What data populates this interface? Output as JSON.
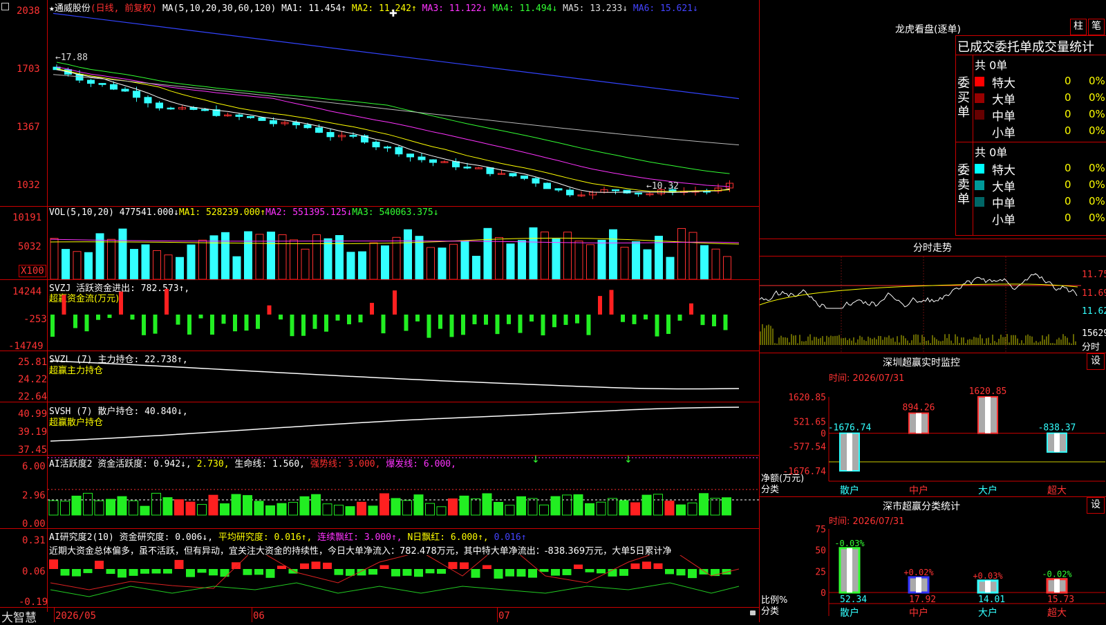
{
  "stock": {
    "name": "★通威股份",
    "mode": "(日线, 前复权)",
    "ma_label": "MA(5,10,20,30,60,120)",
    "ma_values": [
      {
        "label": "MA1:",
        "value": "11.454↑",
        "color": "#ffffff"
      },
      {
        "label": "MA2:",
        "value": "11.242↑",
        "color": "#ffff00"
      },
      {
        "label": "MA3:",
        "value": "11.122↓",
        "color": "#ff33ff"
      },
      {
        "label": "MA4:",
        "value": "11.494↓",
        "color": "#33ff33"
      },
      {
        "label": "MA5:",
        "value": "13.233↓",
        "color": "#dddddd"
      },
      {
        "label": "MA6:",
        "value": "15.621↓",
        "color": "#4444ff"
      }
    ],
    "high_marker": "←17.88",
    "low_marker": "←10.32"
  },
  "price_axis": [
    "2038",
    "1703",
    "1367",
    "1032"
  ],
  "vol": {
    "header": "VOL(5,10,20)",
    "value": "477541.000↓",
    "ma1": "MA1: 528239.000↑",
    "ma2": "MA2: 551395.125↓",
    "ma3": "MA3: 540063.375↓",
    "axis": [
      "10191",
      "5032"
    ],
    "unit": "X100"
  },
  "svzj": {
    "header": "SVZJ  活跃资金进出: 782.573↑,",
    "sub": "超赢资金流(万元)",
    "axis": [
      "14244",
      "-253",
      "-14749"
    ]
  },
  "svzl": {
    "header": "SVZL (7) 主力持仓: 22.738↑,",
    "sub": "超赢主力持仓",
    "axis": [
      "25.81",
      "24.22",
      "22.64"
    ]
  },
  "svsh": {
    "header": "SVSH (7) 散户持仓: 40.840↓,",
    "sub": "超赢散户持仓",
    "axis": [
      "40.99",
      "39.19",
      "37.45"
    ]
  },
  "ai1": {
    "header": "AI活跃度2 资金活跃度: 0.942↓,",
    "v2": "2.730,",
    "life": "生命线: 1.560,",
    "strong": "强势线: 3.000,",
    "burst": "爆发线: 6.000,",
    "axis": [
      "6.00",
      "2.96",
      "0.00"
    ]
  },
  "ai2": {
    "header": "AI研究度2(10) 资金研究度: 0.006↓,",
    "avg": "平均研究度: 0.016↑,",
    "cont": "连续飘红: 3.000↑,",
    "nday": "N日飘红: 6.000↑,",
    "last": "0.016↑",
    "text": "近期大资金总体偏多，虽不活跃，但有异动，宜关注大资金的持续性，今日大单净流入：782.478万元，其中特大单净流出：-838.369万元，大单5日累计净",
    "axis": [
      "0.31",
      "0.06",
      "-0.19"
    ]
  },
  "bottom": {
    "brand": "大智慧",
    "dates": [
      "2026/05",
      "06",
      "07"
    ]
  },
  "right": {
    "title": "龙虎看盘(逐单)",
    "btn1": "柱",
    "btn2": "笔",
    "stats_title": "已成交委托单成交量统计",
    "buy": {
      "label": "委买单",
      "total": "共 0单",
      "rows": [
        {
          "name": "特大",
          "v": "0",
          "p": "0%",
          "color": "#ff0000"
        },
        {
          "name": "大单",
          "v": "0",
          "p": "0%",
          "color": "#990000"
        },
        {
          "name": "中单",
          "v": "0",
          "p": "0%",
          "color": "#660000"
        },
        {
          "name": "小单",
          "v": "0",
          "p": "0%",
          "color": ""
        }
      ]
    },
    "sell": {
      "label": "委卖单",
      "total": "共 0单",
      "rows": [
        {
          "name": "特大",
          "v": "0",
          "p": "0%",
          "color": "#00ffff"
        },
        {
          "name": "大单",
          "v": "0",
          "p": "0%",
          "color": "#009999"
        },
        {
          "name": "中单",
          "v": "0",
          "p": "0%",
          "color": "#006666"
        },
        {
          "name": "小单",
          "v": "0",
          "p": "0%",
          "color": ""
        }
      ]
    },
    "intraday": {
      "title": "分时走势",
      "axis": [
        "11.75",
        "11.69",
        "11.62"
      ],
      "vol": "15629",
      "unit": "分时"
    },
    "monitor": {
      "title": "深圳超赢实时监控",
      "btn": "设",
      "time": "时间: 2026/07/31",
      "axis": [
        "1620.85",
        "521.65",
        "0",
        "-577.54",
        "-1676.74"
      ],
      "ylabel": "净额(万元)",
      "xlabel": "分类"
    },
    "classify": {
      "title": "深市超赢分类统计",
      "btn": "设",
      "time": "时间: 2026/07/31",
      "axis": [
        "75",
        "50",
        "25",
        "0"
      ],
      "ylabel": "比例%",
      "xlabel": "分类",
      "bottom_values": [
        "52.34",
        "17.92",
        "14.01",
        "15.73"
      ]
    }
  },
  "chart_data": [
    {
      "type": "bar",
      "title": "深圳超赢实时监控",
      "ylabel": "净额(万元)",
      "xlabel": "分类",
      "categories": [
        "散户",
        "中户",
        "大户",
        "超大"
      ],
      "values": [
        -1676.74,
        894.26,
        1620.85,
        -838.37
      ],
      "labels": [
        "-1676.74",
        "894.26",
        "1620.85",
        "-838.37"
      ],
      "ylim": [
        -1676.74,
        1620.85
      ],
      "colors": [
        "#33ffff",
        "#ff3030",
        "#ff3030",
        "#33ffff"
      ]
    },
    {
      "type": "bar",
      "title": "深市超赢分类统计",
      "ylabel": "比例%",
      "xlabel": "分类",
      "categories": [
        "散户",
        "中户",
        "大户",
        "超大"
      ],
      "values": [
        52.34,
        17.92,
        14.01,
        15.73
      ],
      "labels": [
        "-0.03%",
        "+0.02%",
        "+0.03%",
        "-0.02%"
      ],
      "ylim": [
        0,
        75
      ],
      "colors": [
        "#33ff33",
        "#3333ff",
        "#33ffff",
        "#ff3030"
      ]
    }
  ]
}
